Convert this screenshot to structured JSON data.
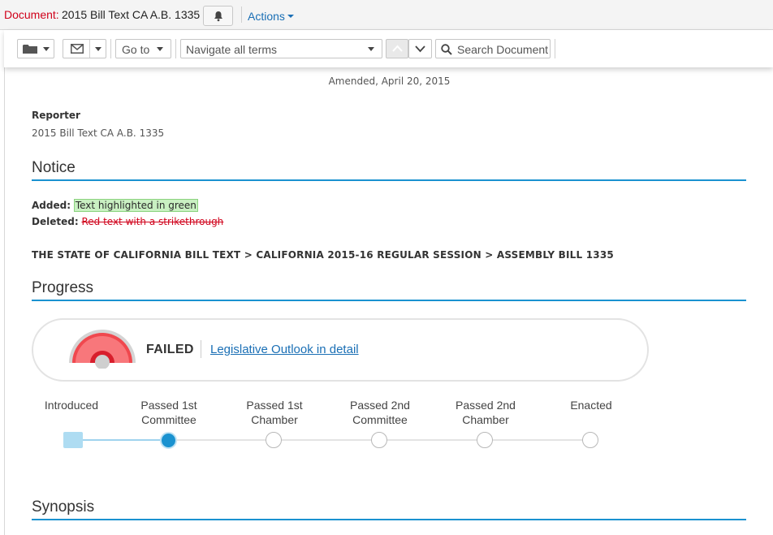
{
  "header": {
    "doc_label": "Document:",
    "doc_title": "2015 Bill Text CA A.B. 1335",
    "actions_label": "Actions"
  },
  "toolbar": {
    "goto_label": "Go to",
    "navigate_placeholder": "Navigate all terms",
    "search_label": "Search Document"
  },
  "document": {
    "amended": "Amended, April 20, 2015",
    "reporter_heading": "Reporter",
    "reporter_value": "2015 Bill Text CA A.B. 1335",
    "notice_heading": "Notice",
    "added_label": "Added:",
    "added_text": "Text highlighted in green",
    "deleted_label": "Deleted:",
    "deleted_text": "Red text with a strikethrough",
    "path": "THE STATE OF CALIFORNIA BILL TEXT > CALIFORNIA 2015-16 REGULAR SESSION > ASSEMBLY BILL 1335",
    "progress_heading": "Progress",
    "status": "FAILED",
    "outlook_link": "Legislative Outlook in detail",
    "stages": [
      {
        "line1": "Introduced",
        "line2": ""
      },
      {
        "line1": "Passed 1st",
        "line2": "Committee"
      },
      {
        "line1": "Passed 1st",
        "line2": "Chamber"
      },
      {
        "line1": "Passed 2nd",
        "line2": "Committee"
      },
      {
        "line1": "Passed 2nd",
        "line2": "Chamber"
      },
      {
        "line1": "Enacted",
        "line2": ""
      }
    ],
    "current_stage_index": 1,
    "synopsis_heading": "Synopsis"
  },
  "colors": {
    "accent": "#1a92d0",
    "link": "#1a6fb5",
    "deleted": "#d0021b",
    "gauge_red": "#f0484e"
  },
  "icons": [
    "bell-icon",
    "folder-icon",
    "mail-icon",
    "search-icon",
    "chevron-up-icon",
    "chevron-down-icon",
    "gauge-icon"
  ]
}
